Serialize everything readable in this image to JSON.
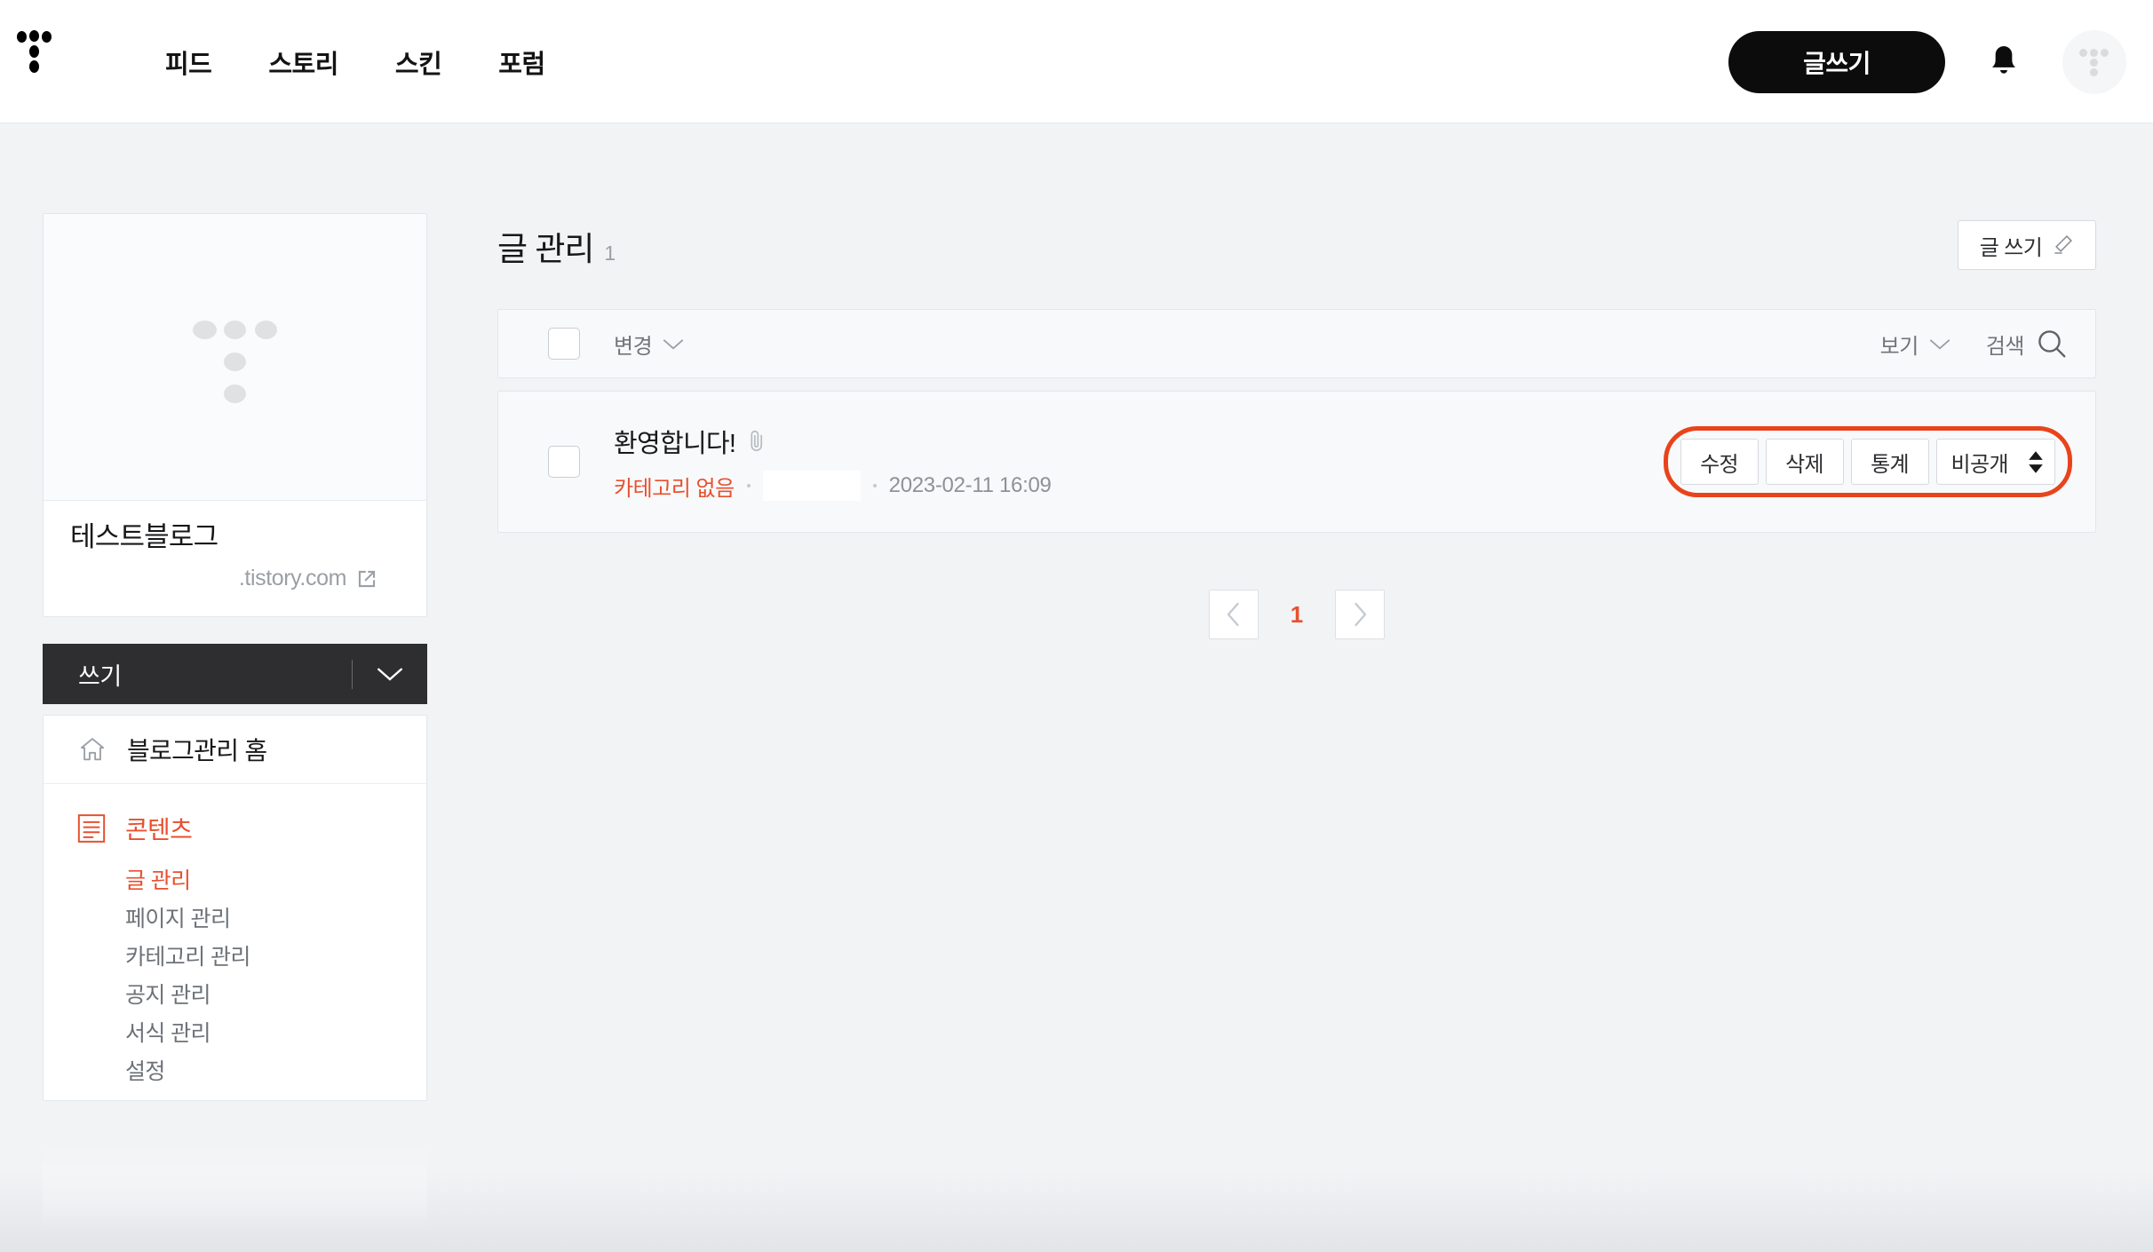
{
  "header": {
    "logo_icon": "tistory-dots-logo",
    "nav": [
      {
        "label": "피드"
      },
      {
        "label": "스토리"
      },
      {
        "label": "스킨"
      },
      {
        "label": "포럼"
      }
    ],
    "write_button": "글쓰기",
    "notification_icon": "bell-icon",
    "avatar_icon": "tistory-dots-avatar"
  },
  "sidebar": {
    "blog": {
      "thumb_icon": "tistory-dots-placeholder",
      "name": "테스트블로그",
      "url": ".tistory.com",
      "external_icon": "external-link-icon"
    },
    "write_dropdown": {
      "label": "쓰기",
      "caret_icon": "chevron-down-icon"
    },
    "home": {
      "icon": "home-icon",
      "label": "블로그관리 홈"
    },
    "section": {
      "icon": "content-list-icon",
      "label": "콘텐츠",
      "items": [
        {
          "label": "글 관리",
          "active": true
        },
        {
          "label": "페이지 관리",
          "active": false
        },
        {
          "label": "카테고리 관리",
          "active": false
        },
        {
          "label": "공지 관리",
          "active": false
        },
        {
          "label": "서식 관리",
          "active": false
        },
        {
          "label": "설정",
          "active": false
        }
      ]
    }
  },
  "main": {
    "title": "글 관리",
    "count": "1",
    "write_button": {
      "label": "글 쓰기",
      "icon": "pencil-icon"
    },
    "toolbar": {
      "select_all_checkbox": "",
      "change_label": "변경",
      "change_caret_icon": "chevron-down-icon",
      "view_label": "보기",
      "view_caret_icon": "chevron-down-icon",
      "search_label": "검색",
      "search_icon": "search-icon"
    },
    "posts": [
      {
        "checkbox": "",
        "title": "환영합니다!",
        "attachment_icon": "paperclip-icon",
        "category": "카테고리 없음",
        "author_redacted": "",
        "date": "2023-02-11 16:09",
        "actions": {
          "edit": "수정",
          "delete": "삭제",
          "stats": "통계",
          "visibility": "비공개",
          "visibility_icon": "updown-spinner-icon",
          "highlight_color": "#e8441c"
        }
      }
    ],
    "pagination": {
      "prev_icon": "chevron-left-icon",
      "pages": [
        "1"
      ],
      "next_icon": "chevron-right-icon"
    }
  },
  "colors": {
    "accent": "#e8502e",
    "highlight": "#e8441c",
    "dark": "#2e2e30",
    "page_bg": "#f1f3f5"
  }
}
